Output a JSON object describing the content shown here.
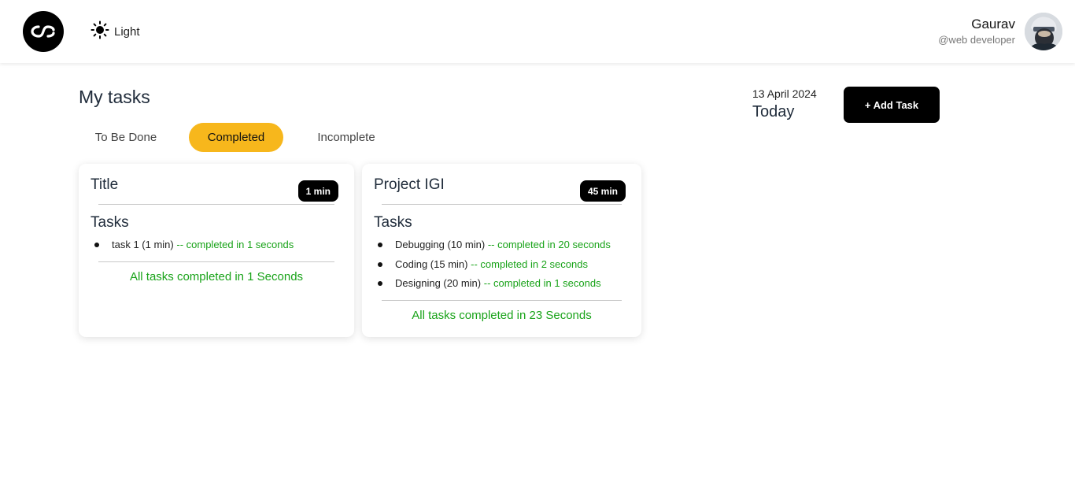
{
  "header": {
    "theme_label": "Light",
    "user_name": "Gaurav",
    "user_handle": "@web developer"
  },
  "main": {
    "title": "My tasks",
    "date": "13 April 2024",
    "today_label": "Today",
    "add_task_label": "+ Add Task",
    "tabs": [
      {
        "label": "To Be Done"
      },
      {
        "label": "Completed"
      },
      {
        "label": "Incomplete"
      }
    ],
    "active_tab": "Completed"
  },
  "cards": [
    {
      "title": "Title",
      "duration": "1 min",
      "tasks_label": "Tasks",
      "tasks": [
        {
          "name": "task 1 (1 min)",
          "status": "-- completed in 1 seconds"
        }
      ],
      "summary": "All tasks completed in 1 Seconds"
    },
    {
      "title": "Project IGI",
      "duration": "45 min",
      "tasks_label": "Tasks",
      "tasks": [
        {
          "name": "Debugging (10 min)",
          "status": "-- completed in 20 seconds"
        },
        {
          "name": "Coding (15 min)",
          "status": "-- completed in 2 seconds"
        },
        {
          "name": "Designing (20 min)",
          "status": "-- completed in 1 seconds"
        }
      ],
      "summary": "All tasks completed in 23 Seconds"
    }
  ],
  "colors": {
    "accent": "#f7b71c",
    "success": "#19a319",
    "dark": "#000000"
  },
  "icons": {
    "logo": "lastfm-logo-icon",
    "theme": "sun-icon"
  }
}
